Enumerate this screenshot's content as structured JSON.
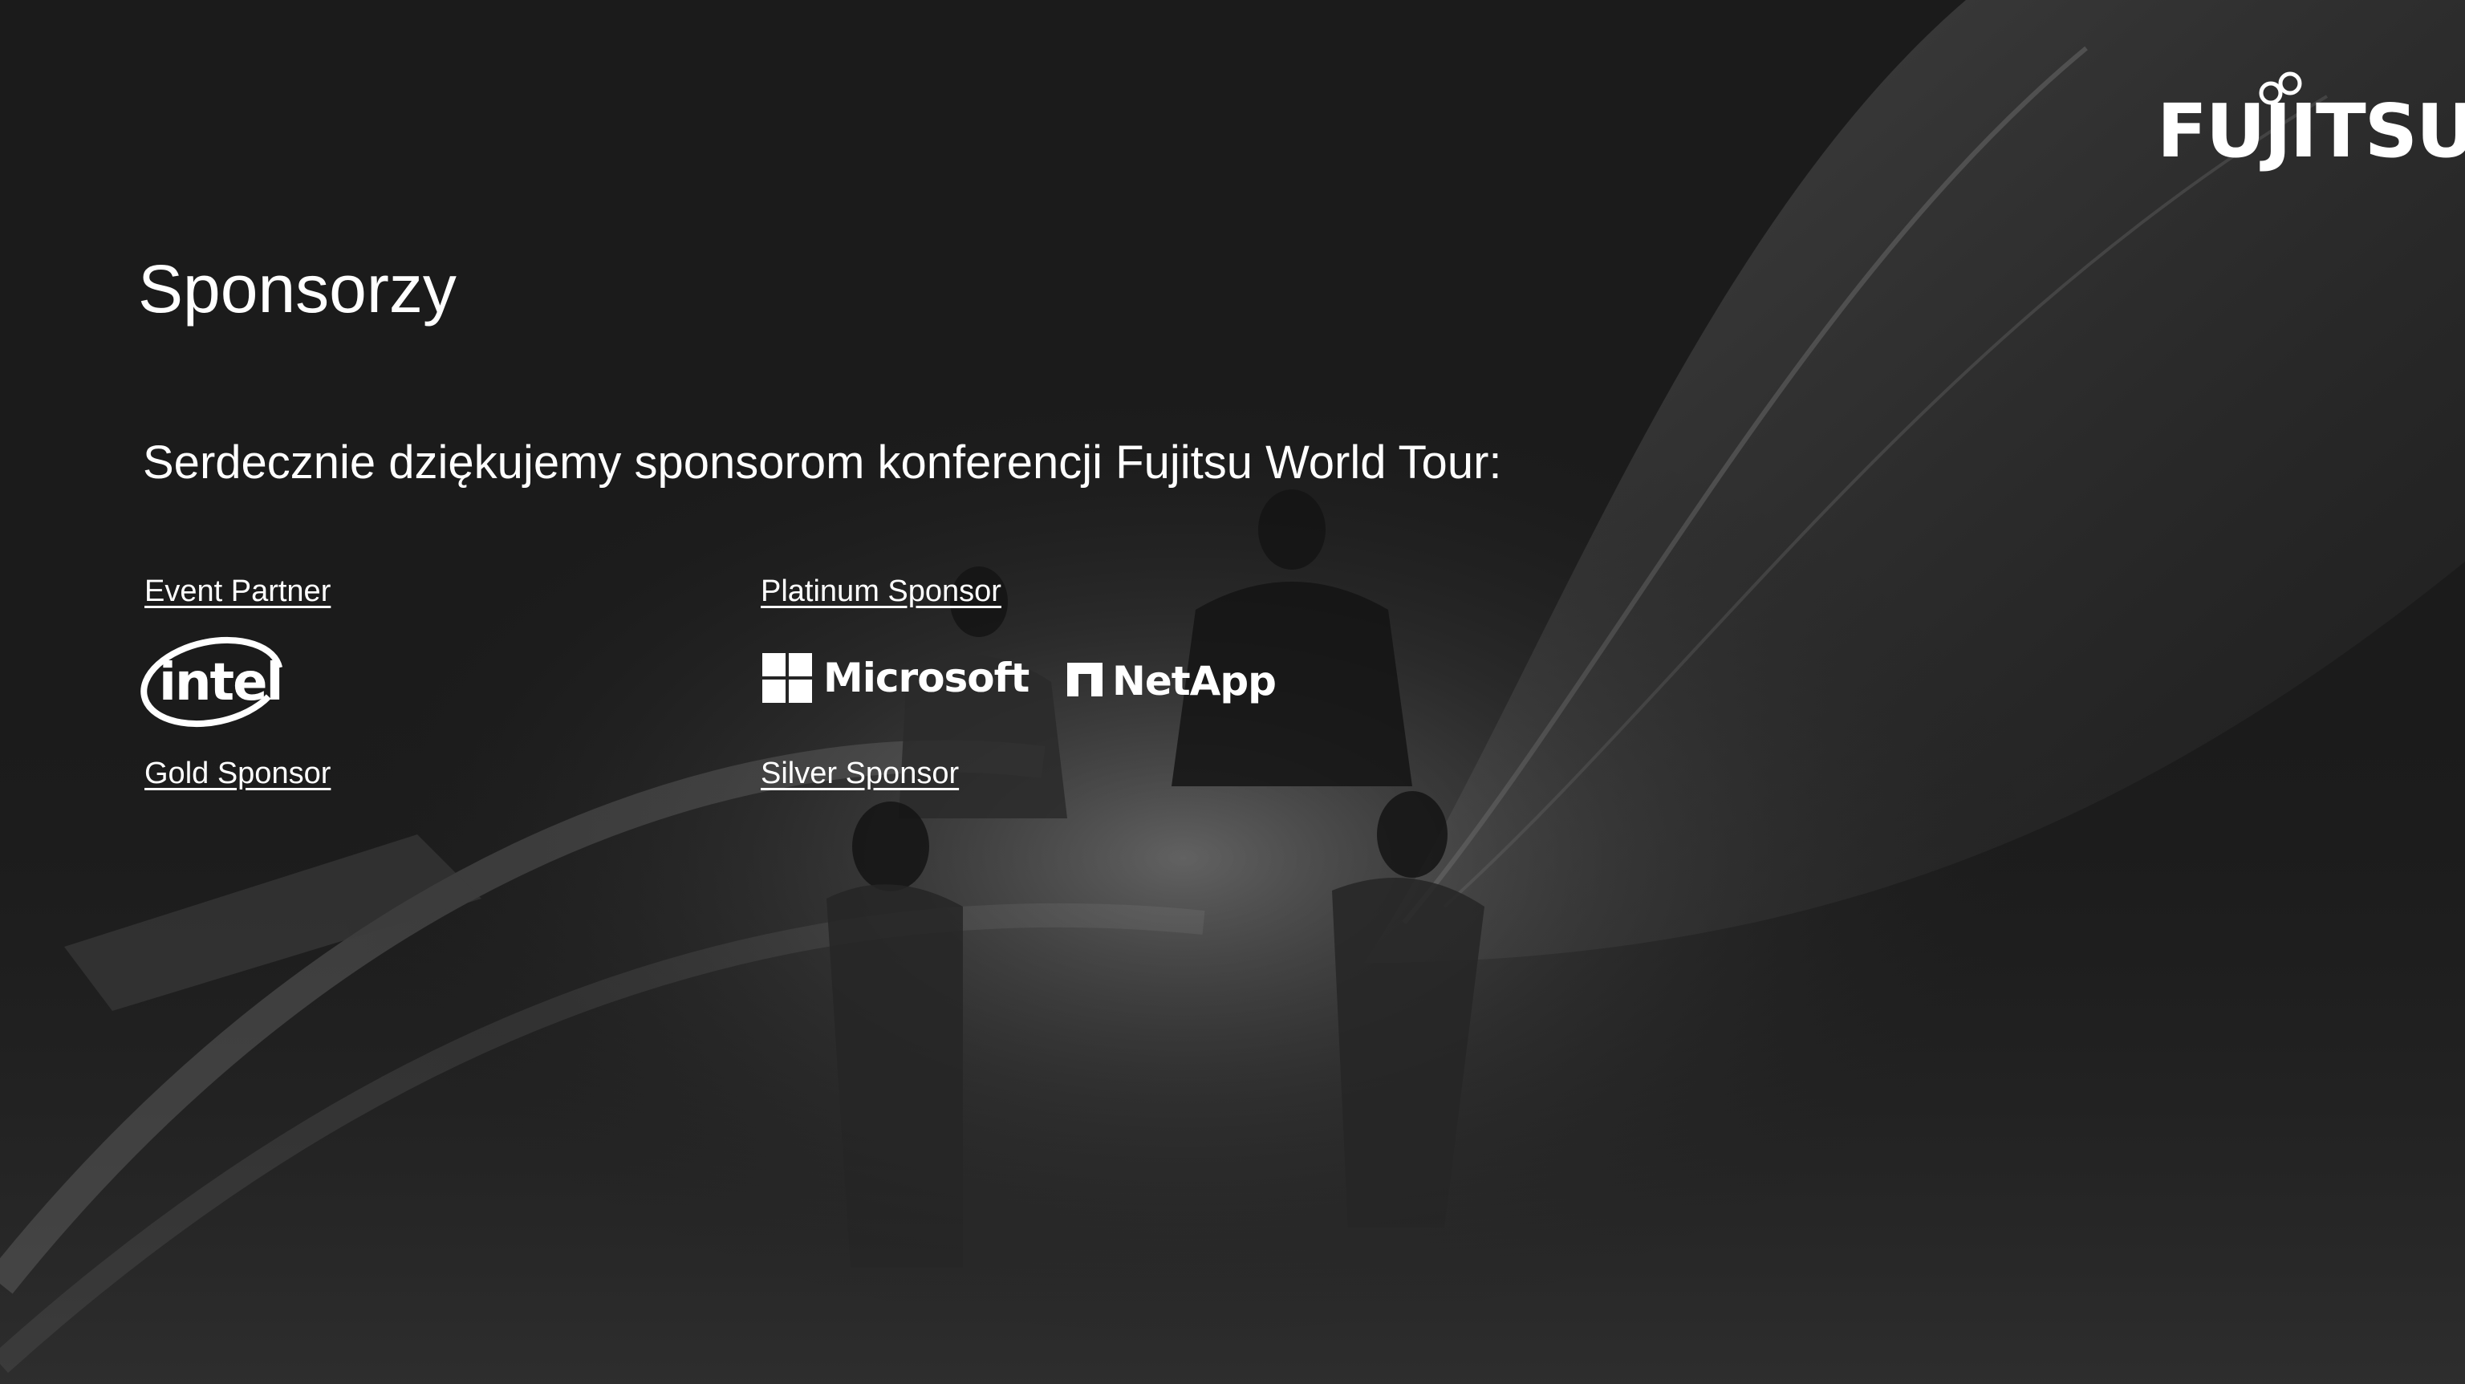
{
  "slide": {
    "title": "Sponsorzy",
    "subtitle": "Serdecznie dziękujemy sponsorom konferencji Fujitsu World Tour:"
  },
  "brand": {
    "logo_text": "FUJITSU"
  },
  "tiers": {
    "event_partner": "Event Partner",
    "platinum_sponsor": "Platinum Sponsor",
    "gold_sponsor": "Gold Sponsor",
    "silver_sponsor": "Silver Sponsor"
  },
  "sponsors": {
    "intel": "intel",
    "microsoft": "Microsoft",
    "netapp": "NetApp"
  },
  "colors": {
    "background": "#1b1b1b",
    "text": "#ffffff",
    "accent_glow": "#8a8a8a"
  }
}
